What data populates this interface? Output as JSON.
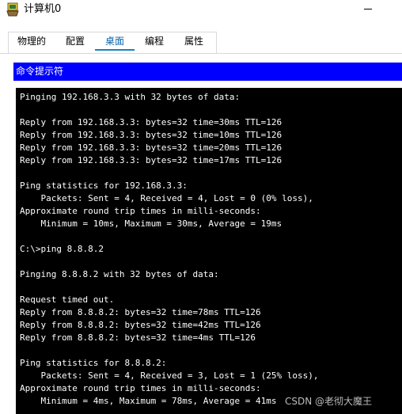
{
  "window": {
    "title": "计算机0"
  },
  "tabs": [
    {
      "label": "物理的",
      "active": false
    },
    {
      "label": "配置",
      "active": false
    },
    {
      "label": "桌面",
      "active": true
    },
    {
      "label": "编程",
      "active": false
    },
    {
      "label": "属性",
      "active": false
    }
  ],
  "panel": {
    "title": "命令提示符"
  },
  "terminal": {
    "lines": [
      "Pinging 192.168.3.3 with 32 bytes of data:",
      "",
      "Reply from 192.168.3.3: bytes=32 time=30ms TTL=126",
      "Reply from 192.168.3.3: bytes=32 time=10ms TTL=126",
      "Reply from 192.168.3.3: bytes=32 time=20ms TTL=126",
      "Reply from 192.168.3.3: bytes=32 time=17ms TTL=126",
      "",
      "Ping statistics for 192.168.3.3:",
      "    Packets: Sent = 4, Received = 4, Lost = 0 (0% loss),",
      "Approximate round trip times in milli-seconds:",
      "    Minimum = 10ms, Maximum = 30ms, Average = 19ms",
      "",
      "C:\\>ping 8.8.8.2",
      "",
      "Pinging 8.8.8.2 with 32 bytes of data:",
      "",
      "Request timed out.",
      "Reply from 8.8.8.2: bytes=32 time=78ms TTL=126",
      "Reply from 8.8.8.2: bytes=32 time=42ms TTL=126",
      "Reply from 8.8.8.2: bytes=32 time=4ms TTL=126",
      "",
      "Ping statistics for 8.8.8.2:",
      "    Packets: Sent = 4, Received = 3, Lost = 1 (25% loss),",
      "Approximate round trip times in milli-seconds:",
      "    Minimum = 4ms, Maximum = 78ms, Average = 41ms"
    ]
  },
  "watermark": {
    "text": "CSDN @老彻大魔王"
  },
  "icons": {
    "app": "computer-app-icon",
    "minimize": "minimize-icon"
  },
  "colors": {
    "panel_header_bg": "#0000ff",
    "terminal_bg": "#000000",
    "terminal_fg": "#ffffff",
    "active_tab": "#1383c5"
  }
}
